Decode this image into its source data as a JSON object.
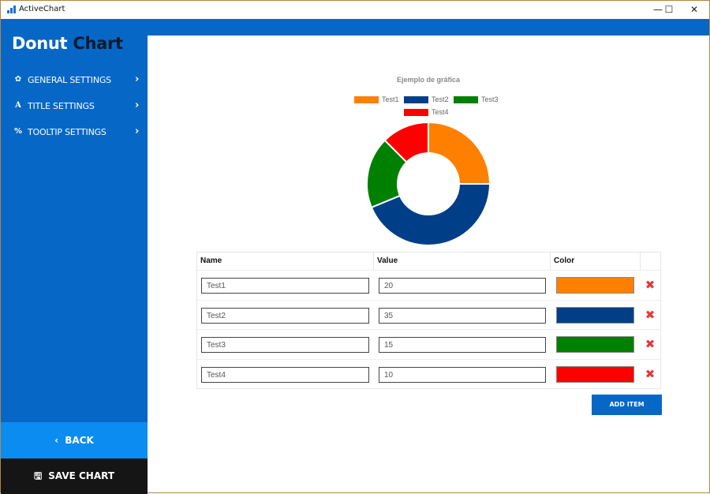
{
  "window": {
    "title": "ActiveChart",
    "controls": {
      "minimize": "—",
      "maximize": "☐",
      "close": "✕"
    }
  },
  "sidebar": {
    "brand_word1": "Donut",
    "brand_word2": "Chart",
    "items": [
      {
        "label": "GENERAL SETTINGS",
        "icon": "gear-icon",
        "glyph": "✿"
      },
      {
        "label": "TITLE SETTINGS",
        "icon": "font-icon",
        "glyph": "A"
      },
      {
        "label": "TOOLTIP SETTINGS",
        "icon": "link-icon",
        "glyph": "%"
      }
    ],
    "chevron": "›",
    "back_label": "BACK",
    "back_glyph": "‹",
    "save_label": "SAVE CHART",
    "save_glyph": "🖫"
  },
  "chart_data": {
    "type": "pie",
    "variant": "donut",
    "title": "Ejemplo de gráfica",
    "categories": [
      "Test1",
      "Test2",
      "Test3",
      "Test4"
    ],
    "values": [
      20,
      35,
      15,
      10
    ],
    "colors": [
      "#ff8000",
      "#003f88",
      "#008000",
      "#ff0000"
    ],
    "legend_position": "top"
  },
  "table": {
    "headers": {
      "name": "Name",
      "value": "Value",
      "color": "Color"
    },
    "rows": [
      {
        "name": "Test1",
        "value": "20",
        "color": "#ff8000"
      },
      {
        "name": "Test2",
        "value": "35",
        "color": "#003f88"
      },
      {
        "name": "Test3",
        "value": "15",
        "color": "#008000"
      },
      {
        "name": "Test4",
        "value": "10",
        "color": "#ff0000"
      }
    ],
    "delete_glyph": "✖",
    "add_label": "ADD ITEM"
  }
}
